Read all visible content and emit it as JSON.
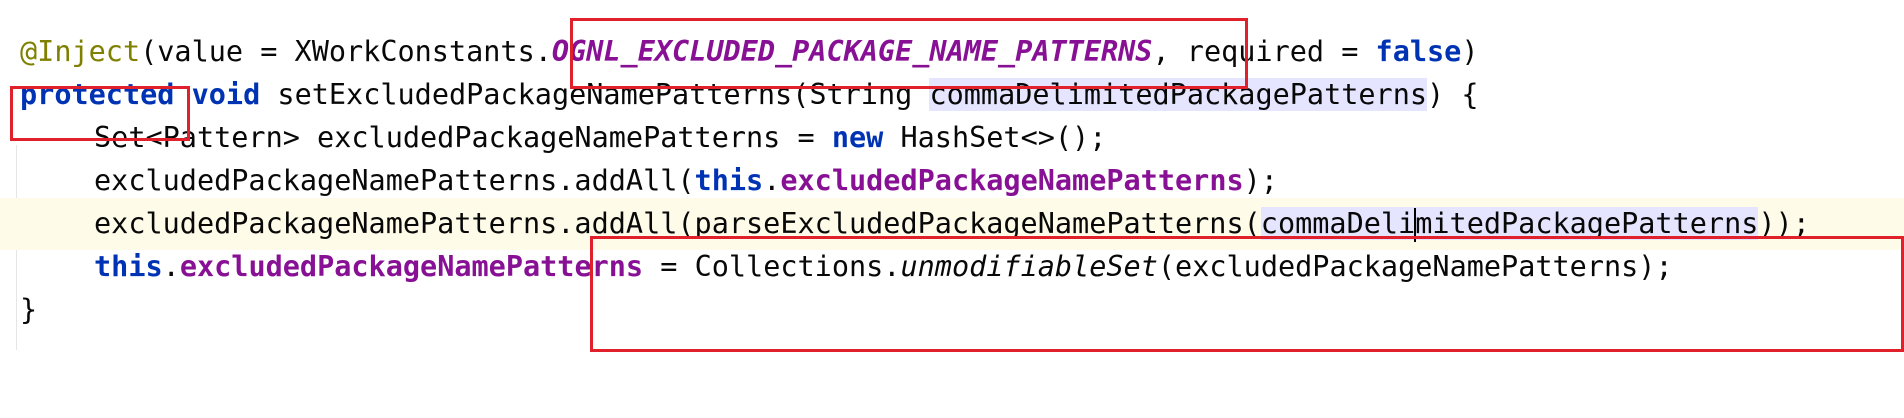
{
  "code": {
    "annotation": "@Inject",
    "l1_open": "(value = XWorkConstants.",
    "l1_constant": "OGNL_EXCLUDED_PACKAGE_NAME_PATTERNS",
    "l1_mid": ", required = ",
    "l1_false": "false",
    "l1_close": ")",
    "kw_protected": "protected",
    "kw_void": "void",
    "l2_method": " setExcludedPackageNamePatterns(String ",
    "l2_param": "commaDelimitedPackagePatterns",
    "l2_close": ") {",
    "l3_decl": "Set<Pattern> excludedPackageNamePatterns = ",
    "kw_new": "new",
    "l3_rest": " HashSet<>();",
    "l4_start": "excludedPackageNamePatterns.addAll(",
    "kw_this": "this",
    "dot": ".",
    "field_name": "excludedPackageNamePatterns",
    "l4_end": ");",
    "l5_start": "excludedPackageNamePatterns.addAll(parseExcludedPackageNamePatterns(",
    "l5_param_a": "commaDeli",
    "l5_param_b": "mitedPackagePatterns",
    "l5_end": "));",
    "l6_mid": " = Collections.",
    "l6_static": "unmodifiableSet",
    "l6_end": "(excludedPackageNamePatterns);",
    "close_brace": "}"
  },
  "highlight_color": "#e0202a"
}
